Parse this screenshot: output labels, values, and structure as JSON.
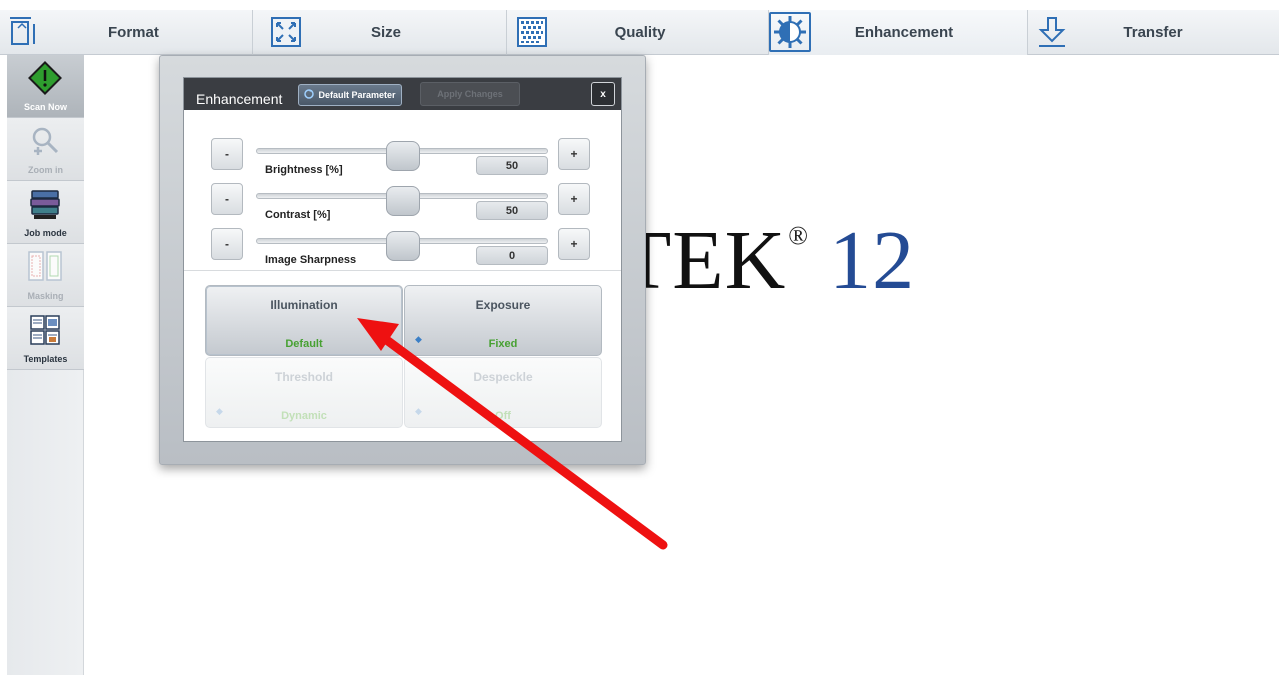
{
  "toolbar": {
    "items": [
      {
        "label": "Format",
        "icon": "format-icon"
      },
      {
        "label": "Size",
        "icon": "size-icon"
      },
      {
        "label": "Quality",
        "icon": "quality-icon"
      },
      {
        "label": "Enhancement",
        "icon": "enhancement-icon"
      },
      {
        "label": "Transfer",
        "icon": "transfer-icon"
      }
    ],
    "active": "Enhancement"
  },
  "sidebar": {
    "items": [
      {
        "label": "Scan Now",
        "icon": "scan-now-icon"
      },
      {
        "label": "Zoom in",
        "icon": "zoom-in-icon"
      },
      {
        "label": "Job mode",
        "icon": "job-mode-icon"
      },
      {
        "label": "Masking",
        "icon": "masking-icon"
      },
      {
        "label": "Templates",
        "icon": "templates-icon"
      }
    ]
  },
  "logo": {
    "text": "TEK",
    "reg": "®",
    "number": "12"
  },
  "dialog": {
    "title": "Enhancement",
    "default_button": "Default Parameter",
    "apply_button": "Apply Changes",
    "close_button": "x",
    "minus": "-",
    "plus": "+",
    "sliders": [
      {
        "label": "Brightness [%]",
        "value": "50",
        "level": 0.5
      },
      {
        "label": "Contrast [%]",
        "value": "50",
        "level": 0.5
      },
      {
        "label": "Image Sharpness",
        "value": "0",
        "level": 0.5
      }
    ],
    "tiles": [
      {
        "title": "Illumination",
        "value": "Default"
      },
      {
        "title": "Exposure",
        "value": "Fixed"
      },
      {
        "title": "Threshold",
        "value": "Dynamic"
      },
      {
        "title": "Despeckle",
        "value": "Off"
      }
    ]
  },
  "colors": {
    "accent": "#2f6fb5",
    "value_green": "#47a132",
    "annotation_arrow": "#ee1111",
    "scan_green": "#2e9d2e"
  }
}
